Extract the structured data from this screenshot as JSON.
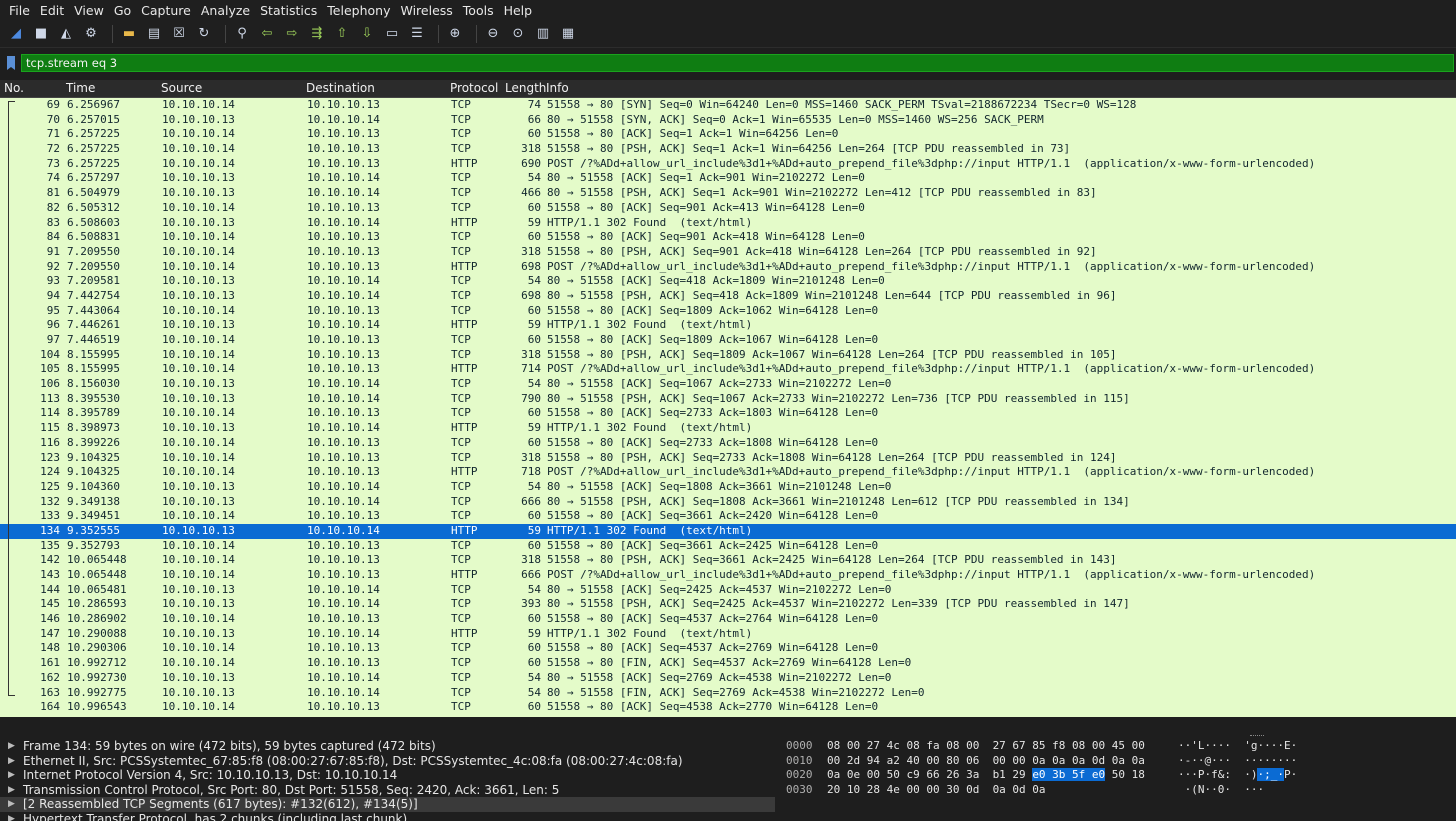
{
  "menu": [
    "File",
    "Edit",
    "View",
    "Go",
    "Capture",
    "Analyze",
    "Statistics",
    "Telephony",
    "Wireless",
    "Tools",
    "Help"
  ],
  "toolbar_icons": [
    "shark-fin-start-icon",
    "stop-capture-icon",
    "restart-capture-icon",
    "capture-options-icon",
    "open-file-icon",
    "save-file-icon",
    "close-file-icon",
    "reload-file-icon",
    "find-packet-icon",
    "go-back-icon",
    "go-forward-icon",
    "go-to-packet-icon",
    "first-packet-icon",
    "last-packet-icon",
    "autoscroll-icon",
    "colorize-icon",
    "zoom-in-icon",
    "zoom-out-icon",
    "normal-size-icon",
    "resize-columns-icon",
    "layout-icon"
  ],
  "filter": {
    "value": "tcp.stream eq 3"
  },
  "columns": {
    "no": "No.",
    "time": "Time",
    "source": "Source",
    "destination": "Destination",
    "protocol": "Protocol",
    "length": "Length",
    "info": "Info"
  },
  "packets": [
    {
      "no": "69",
      "time": "6.256967",
      "src": "10.10.10.14",
      "dst": "10.10.10.13",
      "proto": "TCP",
      "len": "74",
      "info": "51558 → 80 [SYN] Seq=0 Win=64240 Len=0 MSS=1460 SACK_PERM TSval=2188672234 TSecr=0 WS=128"
    },
    {
      "no": "70",
      "time": "6.257015",
      "src": "10.10.10.13",
      "dst": "10.10.10.14",
      "proto": "TCP",
      "len": "66",
      "info": "80 → 51558 [SYN, ACK] Seq=0 Ack=1 Win=65535 Len=0 MSS=1460 WS=256 SACK_PERM"
    },
    {
      "no": "71",
      "time": "6.257225",
      "src": "10.10.10.14",
      "dst": "10.10.10.13",
      "proto": "TCP",
      "len": "60",
      "info": "51558 → 80 [ACK] Seq=1 Ack=1 Win=64256 Len=0"
    },
    {
      "no": "72",
      "time": "6.257225",
      "src": "10.10.10.14",
      "dst": "10.10.10.13",
      "proto": "TCP",
      "len": "318",
      "info": "51558 → 80 [PSH, ACK] Seq=1 Ack=1 Win=64256 Len=264 [TCP PDU reassembled in 73]"
    },
    {
      "no": "73",
      "time": "6.257225",
      "src": "10.10.10.14",
      "dst": "10.10.10.13",
      "proto": "HTTP",
      "len": "690",
      "info": "POST /?%ADd+allow_url_include%3d1+%ADd+auto_prepend_file%3dphp://input HTTP/1.1  (application/x-www-form-urlencoded)"
    },
    {
      "no": "74",
      "time": "6.257297",
      "src": "10.10.10.13",
      "dst": "10.10.10.14",
      "proto": "TCP",
      "len": "54",
      "info": "80 → 51558 [ACK] Seq=1 Ack=901 Win=2102272 Len=0"
    },
    {
      "no": "81",
      "time": "6.504979",
      "src": "10.10.10.13",
      "dst": "10.10.10.14",
      "proto": "TCP",
      "len": "466",
      "info": "80 → 51558 [PSH, ACK] Seq=1 Ack=901 Win=2102272 Len=412 [TCP PDU reassembled in 83]"
    },
    {
      "no": "82",
      "time": "6.505312",
      "src": "10.10.10.14",
      "dst": "10.10.10.13",
      "proto": "TCP",
      "len": "60",
      "info": "51558 → 80 [ACK] Seq=901 Ack=413 Win=64128 Len=0"
    },
    {
      "no": "83",
      "time": "6.508603",
      "src": "10.10.10.13",
      "dst": "10.10.10.14",
      "proto": "HTTP",
      "len": "59",
      "info": "HTTP/1.1 302 Found  (text/html)"
    },
    {
      "no": "84",
      "time": "6.508831",
      "src": "10.10.10.14",
      "dst": "10.10.10.13",
      "proto": "TCP",
      "len": "60",
      "info": "51558 → 80 [ACK] Seq=901 Ack=418 Win=64128 Len=0"
    },
    {
      "no": "91",
      "time": "7.209550",
      "src": "10.10.10.14",
      "dst": "10.10.10.13",
      "proto": "TCP",
      "len": "318",
      "info": "51558 → 80 [PSH, ACK] Seq=901 Ack=418 Win=64128 Len=264 [TCP PDU reassembled in 92]"
    },
    {
      "no": "92",
      "time": "7.209550",
      "src": "10.10.10.14",
      "dst": "10.10.10.13",
      "proto": "HTTP",
      "len": "698",
      "info": "POST /?%ADd+allow_url_include%3d1+%ADd+auto_prepend_file%3dphp://input HTTP/1.1  (application/x-www-form-urlencoded)"
    },
    {
      "no": "93",
      "time": "7.209581",
      "src": "10.10.10.13",
      "dst": "10.10.10.14",
      "proto": "TCP",
      "len": "54",
      "info": "80 → 51558 [ACK] Seq=418 Ack=1809 Win=2101248 Len=0"
    },
    {
      "no": "94",
      "time": "7.442754",
      "src": "10.10.10.13",
      "dst": "10.10.10.14",
      "proto": "TCP",
      "len": "698",
      "info": "80 → 51558 [PSH, ACK] Seq=418 Ack=1809 Win=2101248 Len=644 [TCP PDU reassembled in 96]"
    },
    {
      "no": "95",
      "time": "7.443064",
      "src": "10.10.10.14",
      "dst": "10.10.10.13",
      "proto": "TCP",
      "len": "60",
      "info": "51558 → 80 [ACK] Seq=1809 Ack=1062 Win=64128 Len=0"
    },
    {
      "no": "96",
      "time": "7.446261",
      "src": "10.10.10.13",
      "dst": "10.10.10.14",
      "proto": "HTTP",
      "len": "59",
      "info": "HTTP/1.1 302 Found  (text/html)"
    },
    {
      "no": "97",
      "time": "7.446519",
      "src": "10.10.10.14",
      "dst": "10.10.10.13",
      "proto": "TCP",
      "len": "60",
      "info": "51558 → 80 [ACK] Seq=1809 Ack=1067 Win=64128 Len=0"
    },
    {
      "no": "104",
      "time": "8.155995",
      "src": "10.10.10.14",
      "dst": "10.10.10.13",
      "proto": "TCP",
      "len": "318",
      "info": "51558 → 80 [PSH, ACK] Seq=1809 Ack=1067 Win=64128 Len=264 [TCP PDU reassembled in 105]"
    },
    {
      "no": "105",
      "time": "8.155995",
      "src": "10.10.10.14",
      "dst": "10.10.10.13",
      "proto": "HTTP",
      "len": "714",
      "info": "POST /?%ADd+allow_url_include%3d1+%ADd+auto_prepend_file%3dphp://input HTTP/1.1  (application/x-www-form-urlencoded)"
    },
    {
      "no": "106",
      "time": "8.156030",
      "src": "10.10.10.13",
      "dst": "10.10.10.14",
      "proto": "TCP",
      "len": "54",
      "info": "80 → 51558 [ACK] Seq=1067 Ack=2733 Win=2102272 Len=0"
    },
    {
      "no": "113",
      "time": "8.395530",
      "src": "10.10.10.13",
      "dst": "10.10.10.14",
      "proto": "TCP",
      "len": "790",
      "info": "80 → 51558 [PSH, ACK] Seq=1067 Ack=2733 Win=2102272 Len=736 [TCP PDU reassembled in 115]"
    },
    {
      "no": "114",
      "time": "8.395789",
      "src": "10.10.10.14",
      "dst": "10.10.10.13",
      "proto": "TCP",
      "len": "60",
      "info": "51558 → 80 [ACK] Seq=2733 Ack=1803 Win=64128 Len=0"
    },
    {
      "no": "115",
      "time": "8.398973",
      "src": "10.10.10.13",
      "dst": "10.10.10.14",
      "proto": "HTTP",
      "len": "59",
      "info": "HTTP/1.1 302 Found  (text/html)"
    },
    {
      "no": "116",
      "time": "8.399226",
      "src": "10.10.10.14",
      "dst": "10.10.10.13",
      "proto": "TCP",
      "len": "60",
      "info": "51558 → 80 [ACK] Seq=2733 Ack=1808 Win=64128 Len=0"
    },
    {
      "no": "123",
      "time": "9.104325",
      "src": "10.10.10.14",
      "dst": "10.10.10.13",
      "proto": "TCP",
      "len": "318",
      "info": "51558 → 80 [PSH, ACK] Seq=2733 Ack=1808 Win=64128 Len=264 [TCP PDU reassembled in 124]"
    },
    {
      "no": "124",
      "time": "9.104325",
      "src": "10.10.10.14",
      "dst": "10.10.10.13",
      "proto": "HTTP",
      "len": "718",
      "info": "POST /?%ADd+allow_url_include%3d1+%ADd+auto_prepend_file%3dphp://input HTTP/1.1  (application/x-www-form-urlencoded)"
    },
    {
      "no": "125",
      "time": "9.104360",
      "src": "10.10.10.13",
      "dst": "10.10.10.14",
      "proto": "TCP",
      "len": "54",
      "info": "80 → 51558 [ACK] Seq=1808 Ack=3661 Win=2101248 Len=0"
    },
    {
      "no": "132",
      "time": "9.349138",
      "src": "10.10.10.13",
      "dst": "10.10.10.14",
      "proto": "TCP",
      "len": "666",
      "info": "80 → 51558 [PSH, ACK] Seq=1808 Ack=3661 Win=2101248 Len=612 [TCP PDU reassembled in 134]"
    },
    {
      "no": "133",
      "time": "9.349451",
      "src": "10.10.10.14",
      "dst": "10.10.10.13",
      "proto": "TCP",
      "len": "60",
      "info": "51558 → 80 [ACK] Seq=3661 Ack=2420 Win=64128 Len=0"
    },
    {
      "no": "134",
      "time": "9.352555",
      "src": "10.10.10.13",
      "dst": "10.10.10.14",
      "proto": "HTTP",
      "len": "59",
      "info": "HTTP/1.1 302 Found  (text/html)",
      "selected": true
    },
    {
      "no": "135",
      "time": "9.352793",
      "src": "10.10.10.14",
      "dst": "10.10.10.13",
      "proto": "TCP",
      "len": "60",
      "info": "51558 → 80 [ACK] Seq=3661 Ack=2425 Win=64128 Len=0"
    },
    {
      "no": "142",
      "time": "10.065448",
      "src": "10.10.10.14",
      "dst": "10.10.10.13",
      "proto": "TCP",
      "len": "318",
      "info": "51558 → 80 [PSH, ACK] Seq=3661 Ack=2425 Win=64128 Len=264 [TCP PDU reassembled in 143]"
    },
    {
      "no": "143",
      "time": "10.065448",
      "src": "10.10.10.14",
      "dst": "10.10.10.13",
      "proto": "HTTP",
      "len": "666",
      "info": "POST /?%ADd+allow_url_include%3d1+%ADd+auto_prepend_file%3dphp://input HTTP/1.1  (application/x-www-form-urlencoded)"
    },
    {
      "no": "144",
      "time": "10.065481",
      "src": "10.10.10.13",
      "dst": "10.10.10.14",
      "proto": "TCP",
      "len": "54",
      "info": "80 → 51558 [ACK] Seq=2425 Ack=4537 Win=2102272 Len=0"
    },
    {
      "no": "145",
      "time": "10.286593",
      "src": "10.10.10.13",
      "dst": "10.10.10.14",
      "proto": "TCP",
      "len": "393",
      "info": "80 → 51558 [PSH, ACK] Seq=2425 Ack=4537 Win=2102272 Len=339 [TCP PDU reassembled in 147]"
    },
    {
      "no": "146",
      "time": "10.286902",
      "src": "10.10.10.14",
      "dst": "10.10.10.13",
      "proto": "TCP",
      "len": "60",
      "info": "51558 → 80 [ACK] Seq=4537 Ack=2764 Win=64128 Len=0"
    },
    {
      "no": "147",
      "time": "10.290088",
      "src": "10.10.10.13",
      "dst": "10.10.10.14",
      "proto": "HTTP",
      "len": "59",
      "info": "HTTP/1.1 302 Found  (text/html)"
    },
    {
      "no": "148",
      "time": "10.290306",
      "src": "10.10.10.14",
      "dst": "10.10.10.13",
      "proto": "TCP",
      "len": "60",
      "info": "51558 → 80 [ACK] Seq=4537 Ack=2769 Win=64128 Len=0"
    },
    {
      "no": "161",
      "time": "10.992712",
      "src": "10.10.10.14",
      "dst": "10.10.10.13",
      "proto": "TCP",
      "len": "60",
      "info": "51558 → 80 [FIN, ACK] Seq=4537 Ack=2769 Win=64128 Len=0"
    },
    {
      "no": "162",
      "time": "10.992730",
      "src": "10.10.10.13",
      "dst": "10.10.10.14",
      "proto": "TCP",
      "len": "54",
      "info": "80 → 51558 [ACK] Seq=2769 Ack=4538 Win=2102272 Len=0"
    },
    {
      "no": "163",
      "time": "10.992775",
      "src": "10.10.10.13",
      "dst": "10.10.10.14",
      "proto": "TCP",
      "len": "54",
      "info": "80 → 51558 [FIN, ACK] Seq=2769 Ack=4538 Win=2102272 Len=0"
    },
    {
      "no": "164",
      "time": "10.996543",
      "src": "10.10.10.14",
      "dst": "10.10.10.13",
      "proto": "TCP",
      "len": "60",
      "info": "51558 → 80 [ACK] Seq=4538 Ack=2770 Win=64128 Len=0"
    }
  ],
  "details": [
    {
      "text": "Frame 134: 59 bytes on wire (472 bits), 59 bytes captured (472 bits)"
    },
    {
      "text": "Ethernet II, Src: PCSSystemtec_67:85:f8 (08:00:27:67:85:f8), Dst: PCSSystemtec_4c:08:fa (08:00:27:4c:08:fa)"
    },
    {
      "text": "Internet Protocol Version 4, Src: 10.10.10.13, Dst: 10.10.10.14"
    },
    {
      "text": "Transmission Control Protocol, Src Port: 80, Dst Port: 51558, Seq: 2420, Ack: 3661, Len: 5"
    },
    {
      "text": "[2 Reassembled TCP Segments (617 bytes): #132(612), #134(5)]",
      "selected": true
    },
    {
      "text": "Hypertext Transfer Protocol, has 2 chunks (including last chunk)"
    }
  ],
  "bytes": [
    {
      "offset": "0000",
      "hex_pre": "08 00 27 4c 08 fa 08 00  27 67 85 f8 08 00 45 00",
      "hex_hl": "",
      "hex_post": "",
      "ascii_pre": "··'L····  'g····E·",
      "ascii_hl": "",
      "ascii_post": ""
    },
    {
      "offset": "0010",
      "hex_pre": "00 2d 94 a2 40 00 80 06  00 00 0a 0a 0a 0d 0a 0a",
      "hex_hl": "",
      "hex_post": "",
      "ascii_pre": "·-··@···  ········",
      "ascii_hl": "",
      "ascii_post": ""
    },
    {
      "offset": "0020",
      "hex_pre": "0a 0e 00 50 c9 66 26 3a  b1 29 ",
      "hex_hl": "e0 3b 5f e0",
      "hex_post": " 50 18",
      "ascii_pre": "···P·f&:  ·)",
      "ascii_hl": "·;_·",
      "ascii_post": "P·"
    },
    {
      "offset": "0030",
      "hex_pre": "20 10 28 4e 00 00 30 0d  0a 0d 0a",
      "hex_hl": "",
      "hex_post": "",
      "ascii_pre": " ·(N··0·  ···",
      "ascii_hl": "",
      "ascii_post": ""
    }
  ]
}
